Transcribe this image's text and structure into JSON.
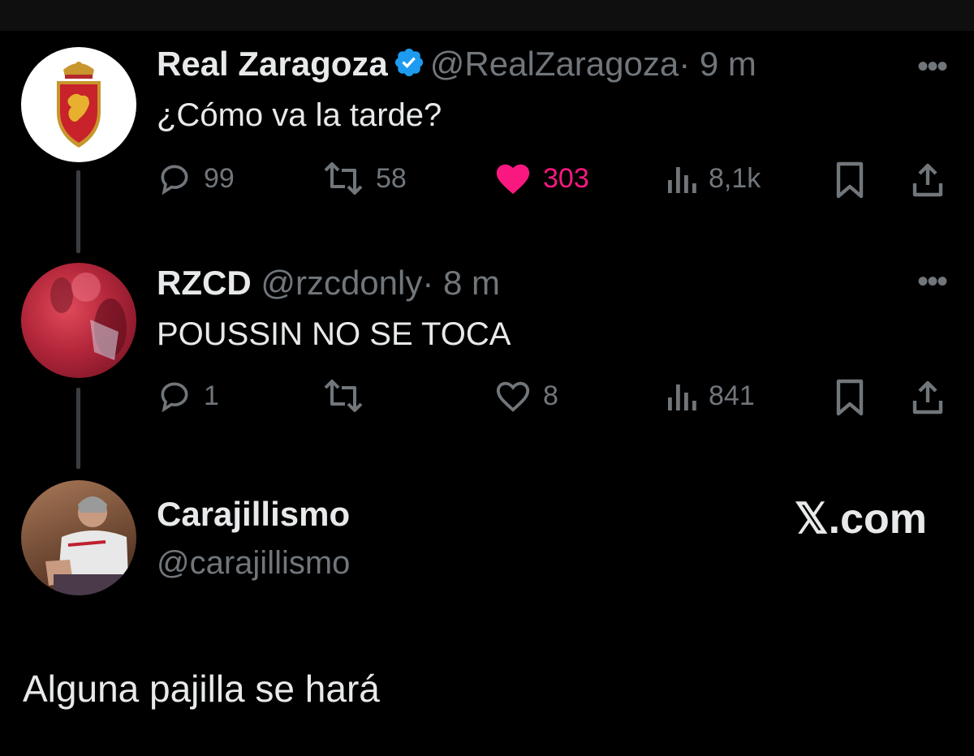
{
  "tweets": [
    {
      "name": "Real Zaragoza",
      "handle": "@RealZaragoza",
      "time": "· 9 m",
      "verified": true,
      "text": "¿Cómo va la tarde?",
      "replies": "99",
      "retweets": "58",
      "likes": "303",
      "liked": true,
      "views": "8,1k"
    },
    {
      "name": "RZCD",
      "handle": "@rzcdonly",
      "time": "· 8 m",
      "verified": false,
      "text": "POUSSIN NO SE TOCA",
      "replies": "1",
      "retweets": "",
      "likes": "8",
      "liked": false,
      "views": "841"
    }
  ],
  "quote_author": {
    "name": "Carajillismo",
    "handle": "@carajillismo"
  },
  "brand": "𝕏.com",
  "quote_text": "Alguna pajilla se hará",
  "colors": {
    "background": "#000000",
    "text": "#e7e9ea",
    "muted": "#71767b",
    "like": "#f91880",
    "verified": "#1d9bf0"
  },
  "icons": [
    "more-icon",
    "verified-icon",
    "reply-icon",
    "retweet-icon",
    "heart-icon",
    "views-icon",
    "bookmark-icon",
    "share-icon"
  ]
}
